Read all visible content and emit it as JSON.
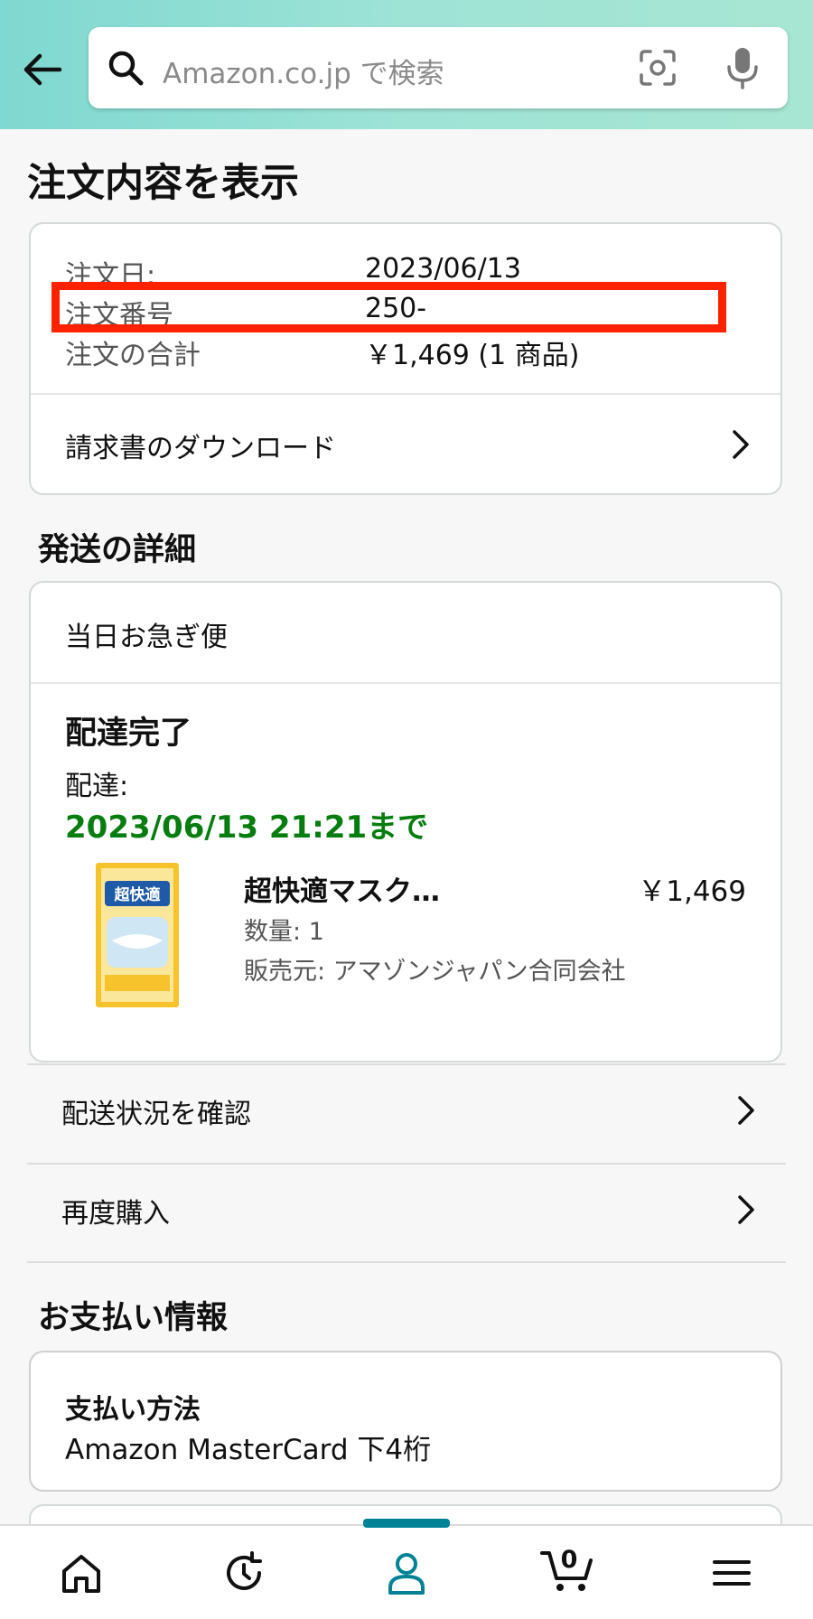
{
  "header": {
    "search_placeholder": "Amazon.co.jp で検索"
  },
  "page": {
    "title": "注文内容を表示"
  },
  "order_summary": {
    "date_label": "注文日:",
    "date_value": "2023/06/13",
    "number_label": "注文番号",
    "number_value": "250-",
    "total_label": "注文の合計",
    "total_value": "￥1,469 (1 商品)",
    "invoice_link": "請求書のダウンロード"
  },
  "shipping": {
    "section_title": "発送の詳細",
    "method": "当日お急ぎ便",
    "status": "配達完了",
    "delivery_label": "配達:",
    "delivery_date": "2023/06/13 21:21まで",
    "product": {
      "name": "超快適マスク…",
      "price": "￥1,469",
      "quantity": "数量: 1",
      "seller": "販売元: アマゾンジャパン合同会社",
      "package_brand": "超快適"
    },
    "track_link": "配送状況を確認",
    "rebuy_link": "再度購入"
  },
  "payment": {
    "section_title": "お支払い情報",
    "method_label": "支払い方法",
    "method_value": "Amazon MasterCard 下4桁"
  },
  "bottom_nav": {
    "cart_count": "0",
    "active_tab": "account"
  },
  "colors": {
    "header_gradient_start": "#7fd8d1",
    "header_gradient_end": "#a7e6d2",
    "delivery_green": "#067d0f",
    "active_teal": "#008296",
    "highlight_red": "#ff2200"
  }
}
